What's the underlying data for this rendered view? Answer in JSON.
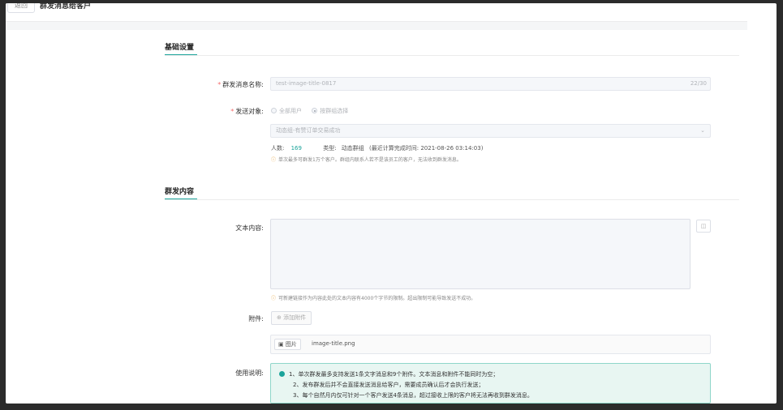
{
  "header": {
    "back_label": "返回",
    "title": "群发消息给客户"
  },
  "sections": {
    "basic": "基础设置",
    "content": "群发内容"
  },
  "form": {
    "name_label": "群发消息名称:",
    "name_value": "test-image-title-0817",
    "name_counter": "22/30",
    "target_label": "发送对象:",
    "target_options": [
      "全部用户",
      "按群组选择"
    ],
    "group_select_value": "动态组-有赞订单交易成功",
    "count_label": "人数:",
    "count_value": "169",
    "type_label": "类型:",
    "type_value": "动态群组",
    "calc_time": "(最近计算完成时间: 2021-08-26 03:14:03)",
    "target_warning": "单次最多可群发1万个客户。群组内联系人若不是该员工的客户，无法收到群发消息。",
    "text_label": "文本内容:",
    "text_warning": "可新建链接作为内容此处的文本内容有4000个字节的限制。超出限制可能导致发送不成功。",
    "attach_label": "附件:",
    "add_attach_label": "添加附件",
    "attach_type": "图片",
    "attach_name": "image-title.png",
    "usage_label": "使用说明:",
    "usage_lines": [
      "1、单次群发最多支持发送1条文字消息和9个附件。文本消息和附件不能同时为空；",
      "2、发布群发后并不会直接发送消息给客户，需要成员确认后才会执行发送；",
      "3、每个自然月内仅可针对一个客户发送4条消息，超过接收上限的客户将无法再收到群发消息。"
    ]
  },
  "icons": {
    "warning": "warning-circle-icon",
    "emoji": "emoji-icon",
    "add": "plus-circle-icon",
    "image": "image-icon",
    "chevron": "chevron-down-icon"
  },
  "colors": {
    "accent": "#1aa39a",
    "required": "#f56c6c",
    "warning": "#e6a23c",
    "notice_bg": "#e8f6f2"
  }
}
